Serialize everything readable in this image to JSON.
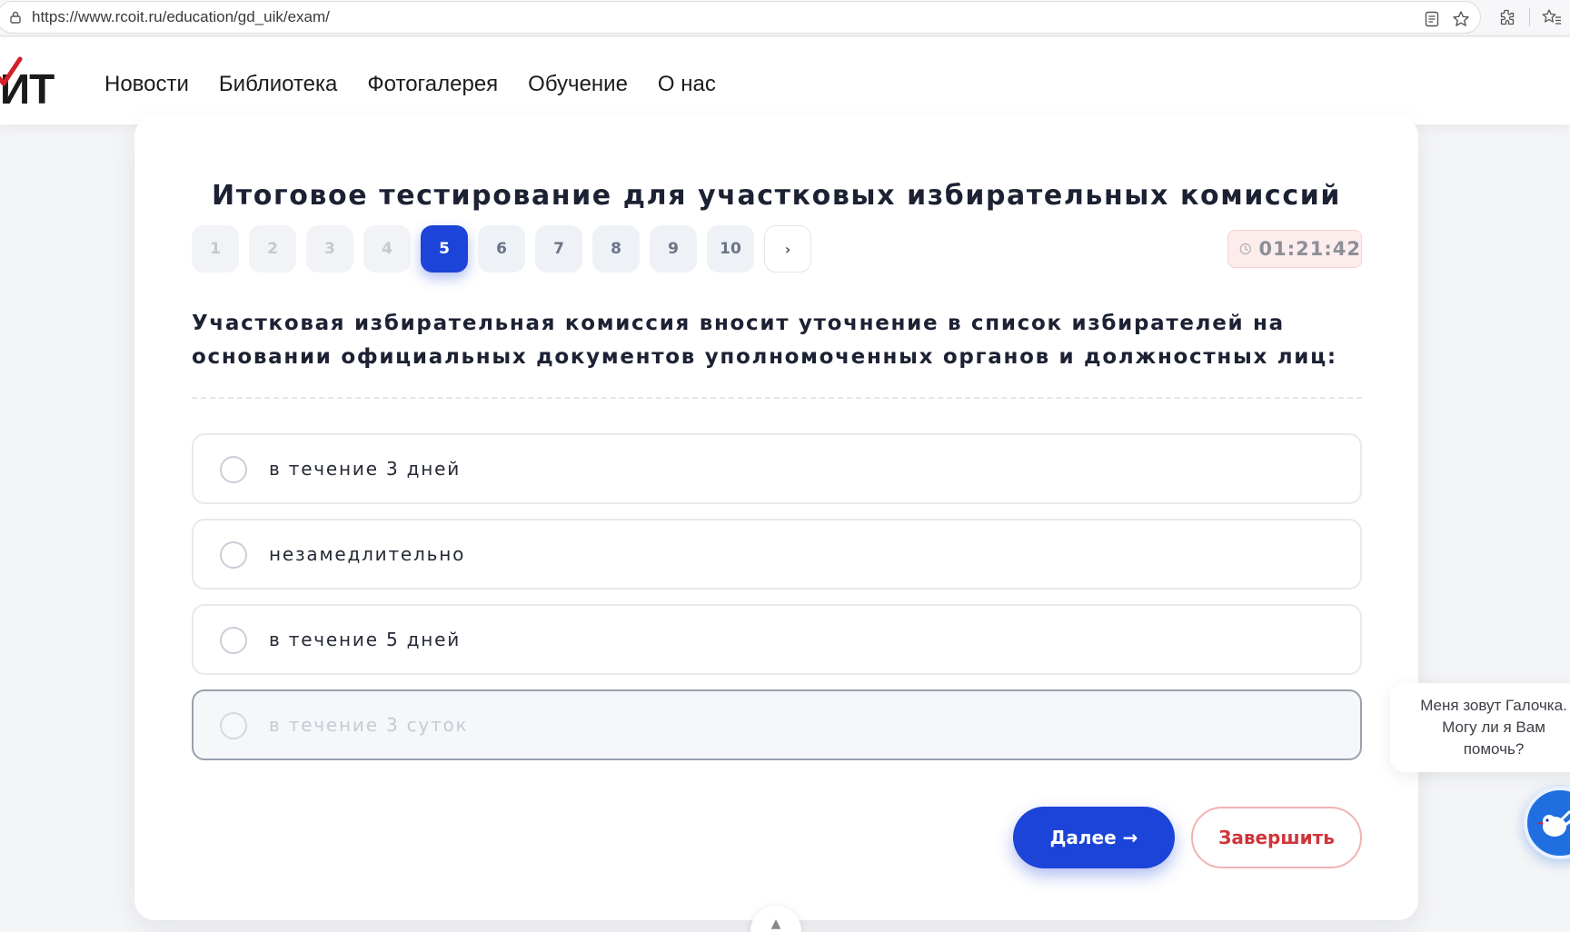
{
  "browser": {
    "url": "https://www.rcoit.ru/education/gd_uik/exam/"
  },
  "header": {
    "logo_text": "ИТ",
    "nav": [
      "Новости",
      "Библиотека",
      "Фотогалерея",
      "Обучение",
      "О нас"
    ]
  },
  "exam": {
    "title": "Итоговое тестирование для участковых избирательных комиссий",
    "pages": [
      "1",
      "2",
      "3",
      "4",
      "5",
      "6",
      "7",
      "8",
      "9",
      "10"
    ],
    "current_page": "5",
    "next_page_symbol": "›",
    "timer": "01:21:42",
    "question": "Участковая избирательная комиссия вносит уточнение в список избирателей на основании официальных документов уполномоченных органов и должностных лиц:",
    "answers": [
      {
        "label": "в течение 3 дней",
        "state": "normal"
      },
      {
        "label": "незамедлительно",
        "state": "normal"
      },
      {
        "label": "в течение 5 дней",
        "state": "normal"
      },
      {
        "label": "в течение 3 суток",
        "state": "disabled"
      }
    ],
    "next_button": "Далее →",
    "finish_button": "Завершить"
  },
  "chat": {
    "lines": [
      "Меня зовут Галочка.",
      "Могу ли я Вам",
      "помочь?"
    ]
  },
  "colors": {
    "accent": "#1d44d8",
    "finish": "#d0343a",
    "timer_bg": "#fdecec"
  }
}
